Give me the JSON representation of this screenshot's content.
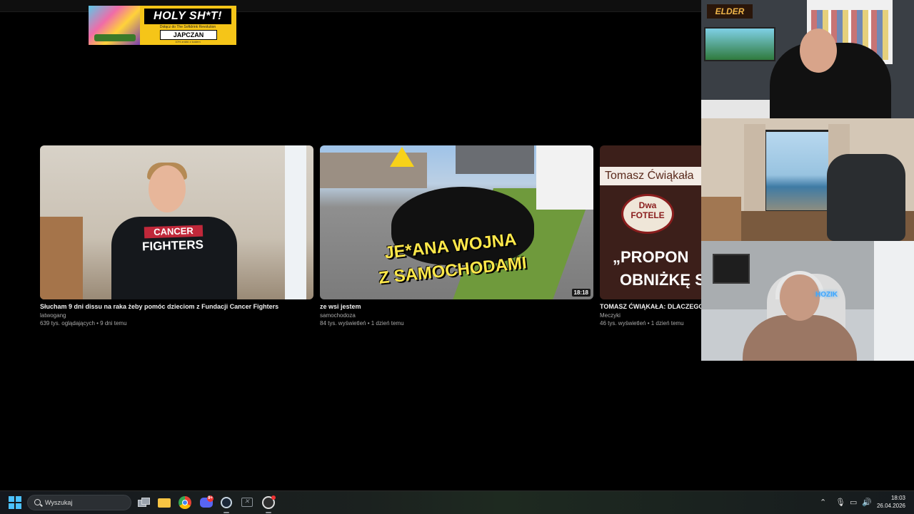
{
  "ad": {
    "headline": "HOLY SH*T!",
    "subtext": "Dołącz do The Softdrink Revolution",
    "brand": "JAPCZAN",
    "note": "10% zniżki z kodem"
  },
  "videos": [
    {
      "title": "Słucham 9 dni dissu na raka żeby pomóc dzieciom z Fundacji Cancer Fighters",
      "channel": "latwogang",
      "meta": "639 tys. oglądających • 9 dni temu",
      "thumb_text": [
        "CANCER",
        "FIGHTERS"
      ],
      "duration": ""
    },
    {
      "title": "ze wsi jestem",
      "channel": "samochodoza",
      "meta": "84 tys. wyświetleń • 1 dzień temu",
      "thumb_text": [
        "JE*ANA WOJNA",
        "Z SAMOCHODAMI"
      ],
      "duration": "18:18"
    },
    {
      "title": "TOMASZ ĆWIĄKAŁA: DLACZEGO (",
      "channel": "Meczyki",
      "meta": "46 tys. wyświetleń • 1 dzień temu",
      "thumb_text": [
        "Tomasz Ćwiąkała",
        "Dwa FOTELE",
        "„PROPON",
        "OBNIŻKĘ S"
      ],
      "duration": ""
    }
  ],
  "webcams": {
    "top_logo": "ELDER",
    "bottom_neon": "HOZIK"
  },
  "taskbar": {
    "search_placeholder": "Wyszukaj",
    "discord_badge": "9+",
    "time": "18:03",
    "date": "26.04.2026",
    "tray_icons": [
      "chevron-up-icon",
      "microphone-icon",
      "monitor-icon",
      "speaker-icon"
    ]
  },
  "colors": {
    "accent": "#4cc2ff",
    "ad_yellow": "#f5c518",
    "thumb_text_yellow": "#ffe84a",
    "cancer_red": "#c0283a"
  }
}
